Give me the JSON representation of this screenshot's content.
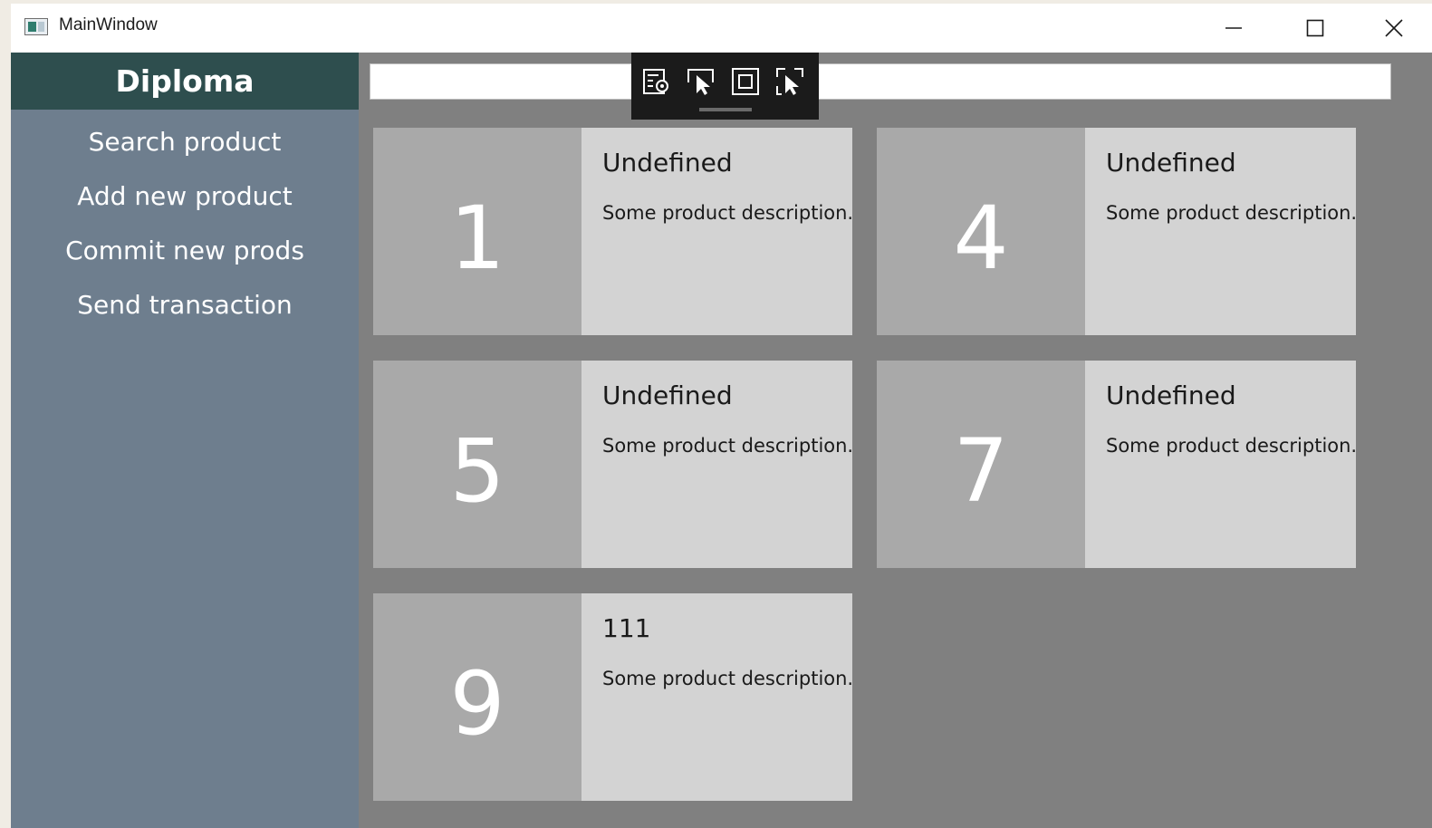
{
  "window": {
    "title": "MainWindow"
  },
  "sidebar": {
    "header": "Diploma",
    "items": [
      {
        "label": "Search product"
      },
      {
        "label": "Add new product"
      },
      {
        "label": "Commit new prods"
      },
      {
        "label": "Send transaction"
      }
    ]
  },
  "search": {
    "value": "",
    "placeholder": ""
  },
  "debug_toolbar": {
    "icons": [
      "live-visual-tree-icon",
      "select-element-icon",
      "display-layout-adorners-icon",
      "track-focused-element-icon"
    ]
  },
  "products": [
    {
      "number": "1",
      "title": "Undefined",
      "description": "Some product description."
    },
    {
      "number": "4",
      "title": "Undefined",
      "description": "Some product description."
    },
    {
      "number": "5",
      "title": "Undefined",
      "description": "Some product description."
    },
    {
      "number": "7",
      "title": "Undefined",
      "description": "Some product description."
    },
    {
      "number": "9",
      "title": "111",
      "description": "Some product description."
    }
  ],
  "colors": {
    "sidebar_header": "#2e4e4e",
    "sidebar": "#6e7e8e",
    "content": "#808080",
    "card_number_bg": "#a9a9a9",
    "card_bg": "#d3d3d3"
  }
}
